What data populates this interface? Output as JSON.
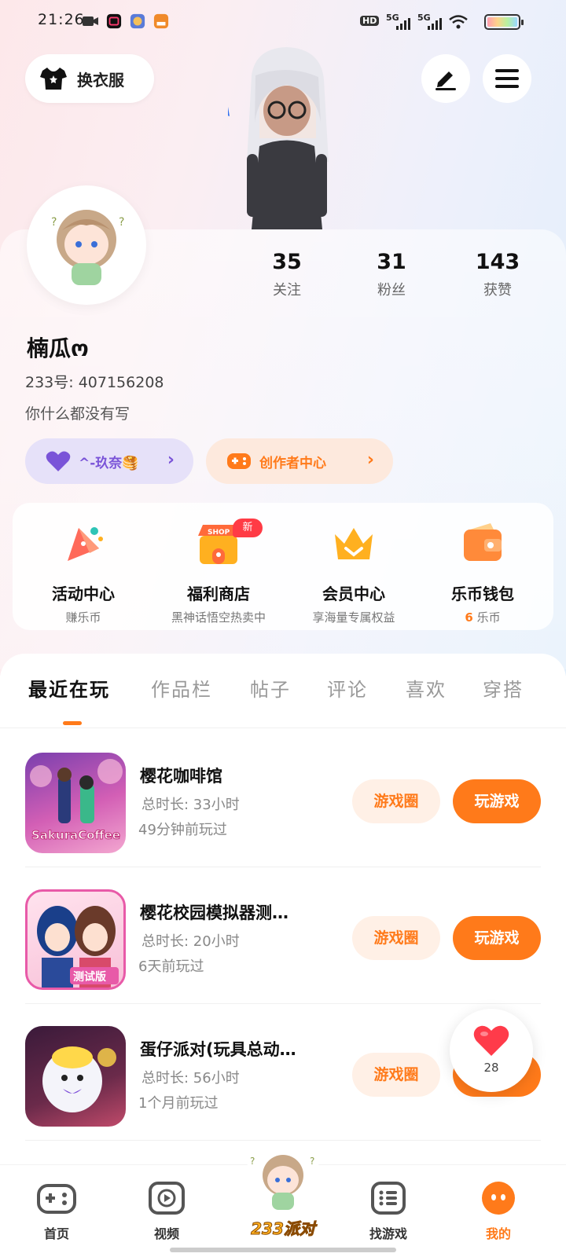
{
  "status_bar": {
    "time": "21:26",
    "network_1": "5G",
    "network_2": "5G",
    "hd_label": "HD"
  },
  "header": {
    "outfit_label": "换衣服",
    "edit_icon": "pen-icon",
    "menu_icon": "menu-icon"
  },
  "profile": {
    "nickname": "楠瓜ო",
    "uid": "233号: 407156208",
    "bio": "你什么都没有写",
    "stats": [
      {
        "value": "35",
        "label": "关注"
      },
      {
        "value": "31",
        "label": "粉丝"
      },
      {
        "value": "143",
        "label": "获赞"
      }
    ],
    "badge_label": "^-玖奈🥞",
    "creator_label": "创作者中心"
  },
  "features": [
    {
      "title": "活动中心",
      "sub": "赚乐币",
      "icon": "party-icon"
    },
    {
      "title": "福利商店",
      "sub": "黑神话悟空热卖中",
      "icon": "shop-icon"
    },
    {
      "title": "会员中心",
      "sub": "享海量专属权益",
      "icon": "crown-icon"
    },
    {
      "title": "乐币钱包",
      "sub_value": "6",
      "sub": "乐币",
      "icon": "wallet-icon"
    }
  ],
  "new_badge": "新",
  "shop_sign": "SHOP",
  "tabs": [
    "最近在玩",
    "作品栏",
    "帖子",
    "评论",
    "喜欢",
    "穿搭"
  ],
  "games": [
    {
      "name": "樱花咖啡馆",
      "duration": "总时长: 33小时",
      "last_played": "49分钟前玩过",
      "circle_label": "游戏圈",
      "play_label": "玩游戏",
      "thumb_text": "SakuraCoffee"
    },
    {
      "name": "樱花校园模拟器测…",
      "duration": "总时长: 20小时",
      "last_played": "6天前玩过",
      "circle_label": "游戏圈",
      "play_label": "玩游戏",
      "thumb_text": "测试版"
    },
    {
      "name": "蛋仔派对(玩具总动…",
      "duration": "总时长: 56小时",
      "last_played": "1个月前玩过",
      "circle_label": "游戏圈",
      "play_label": "玩游戏",
      "thumb_text": ""
    }
  ],
  "like_float": {
    "count": "28"
  },
  "bottom_nav": {
    "items": [
      {
        "label": "首页",
        "icon": "gamepad-icon"
      },
      {
        "label": "视频",
        "icon": "video-icon"
      },
      {
        "label": "233派对",
        "icon": "party-avatar-icon"
      },
      {
        "label": "找游戏",
        "icon": "list-icon"
      },
      {
        "label": "我的",
        "icon": "profile-icon"
      }
    ],
    "active_index": 4
  },
  "colors": {
    "accent": "#ff7a1a",
    "badge_purple": "#e6e1f9",
    "creator_bg": "#fde9dd"
  }
}
